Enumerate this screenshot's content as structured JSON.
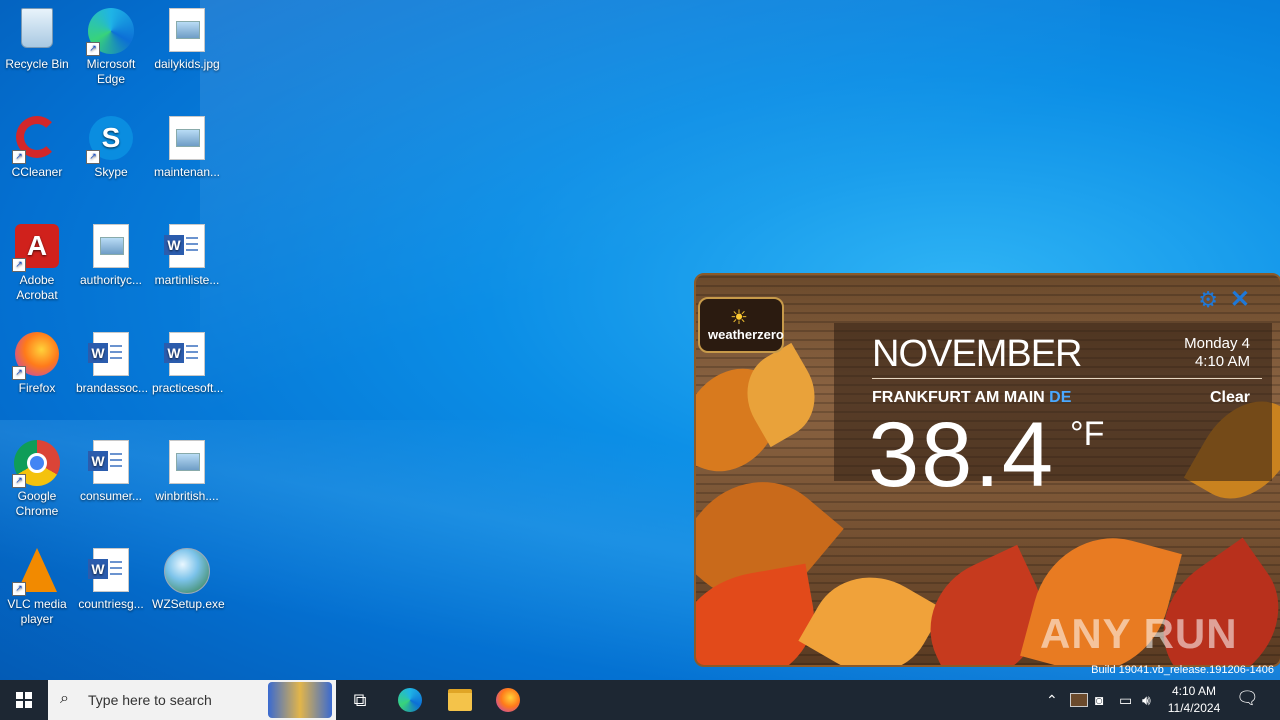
{
  "desktop": {
    "icons": [
      {
        "label": "Recycle Bin"
      },
      {
        "label": "Microsoft Edge"
      },
      {
        "label": "dailykids.jpg"
      },
      {
        "label": "CCleaner"
      },
      {
        "label": "Skype"
      },
      {
        "label": "maintenan..."
      },
      {
        "label": "Adobe Acrobat"
      },
      {
        "label": "authorityc..."
      },
      {
        "label": "martinliste..."
      },
      {
        "label": "Firefox"
      },
      {
        "label": "brandassoc..."
      },
      {
        "label": "practicesoft..."
      },
      {
        "label": "Google Chrome"
      },
      {
        "label": "consumer..."
      },
      {
        "label": "winbritish...."
      },
      {
        "label": "VLC media player"
      },
      {
        "label": "countriesg..."
      },
      {
        "label": "WZSetup.exe"
      }
    ]
  },
  "widget": {
    "logo_text": "weatherzero",
    "month": "NOVEMBER",
    "day": "Monday 4",
    "time": "4:10 AM",
    "city": "FRANKFURT AM MAIN",
    "country_code": "DE",
    "condition": "Clear",
    "temperature": "38.4",
    "unit": "°F",
    "accent_color": "#1e78d8"
  },
  "watermark": "ANY RUN",
  "build_text": "Build 19041.vb_release.191206-1406",
  "taskbar": {
    "search_placeholder": "Type here to search",
    "clock_time": "4:10 AM",
    "clock_date": "11/4/2024"
  }
}
